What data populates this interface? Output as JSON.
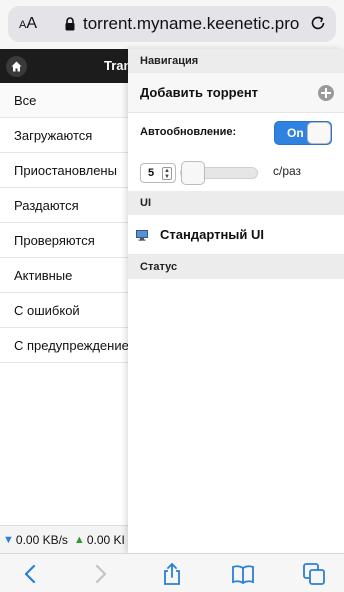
{
  "browser": {
    "aa_label": "AA",
    "url": "torrent.myname.keenetic.pro"
  },
  "app": {
    "title": "Tran"
  },
  "filters": [
    "Все",
    "Загружаются",
    "Приостановлены",
    "Раздаются",
    "Проверяются",
    "Активные",
    "С ошибкой",
    "С предупреждение"
  ],
  "status": {
    "download": "0.00 KB/s",
    "upload": "0.00 KI"
  },
  "panel": {
    "nav_header": "Навигация",
    "add_torrent": "Добавить торрент",
    "autorefresh_label": "Автообновление:",
    "toggle_label": "On",
    "rate_value": "5",
    "rate_unit": "с/раз",
    "ui_header": "UI",
    "standard_ui": "Стандартный UI",
    "status_header": "Статус"
  },
  "colors": {
    "accent": "#2f82e0",
    "safari_icons": "#2a7fd6"
  }
}
